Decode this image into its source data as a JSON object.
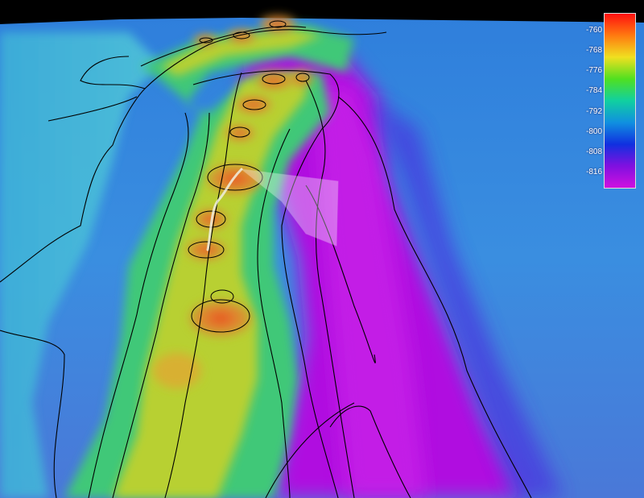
{
  "legend": {
    "ticks": [
      "-760",
      "-768",
      "-776",
      "-784",
      "-792",
      "-800",
      "-808",
      "-816"
    ],
    "colors_top_to_bottom": [
      "#ff1010",
      "#ff7a10",
      "#f0e020",
      "#50e020",
      "#10d0a0",
      "#1090e0",
      "#1030e0",
      "#8010e0",
      "#d010e0"
    ]
  },
  "scene": {
    "sky_color": "#000000",
    "deep_color": "#b010e0",
    "shallow_color": "#e03010",
    "contour_color": "#000000",
    "track_color": "#f0f0e0",
    "viewshed_color": "#ffffff"
  }
}
